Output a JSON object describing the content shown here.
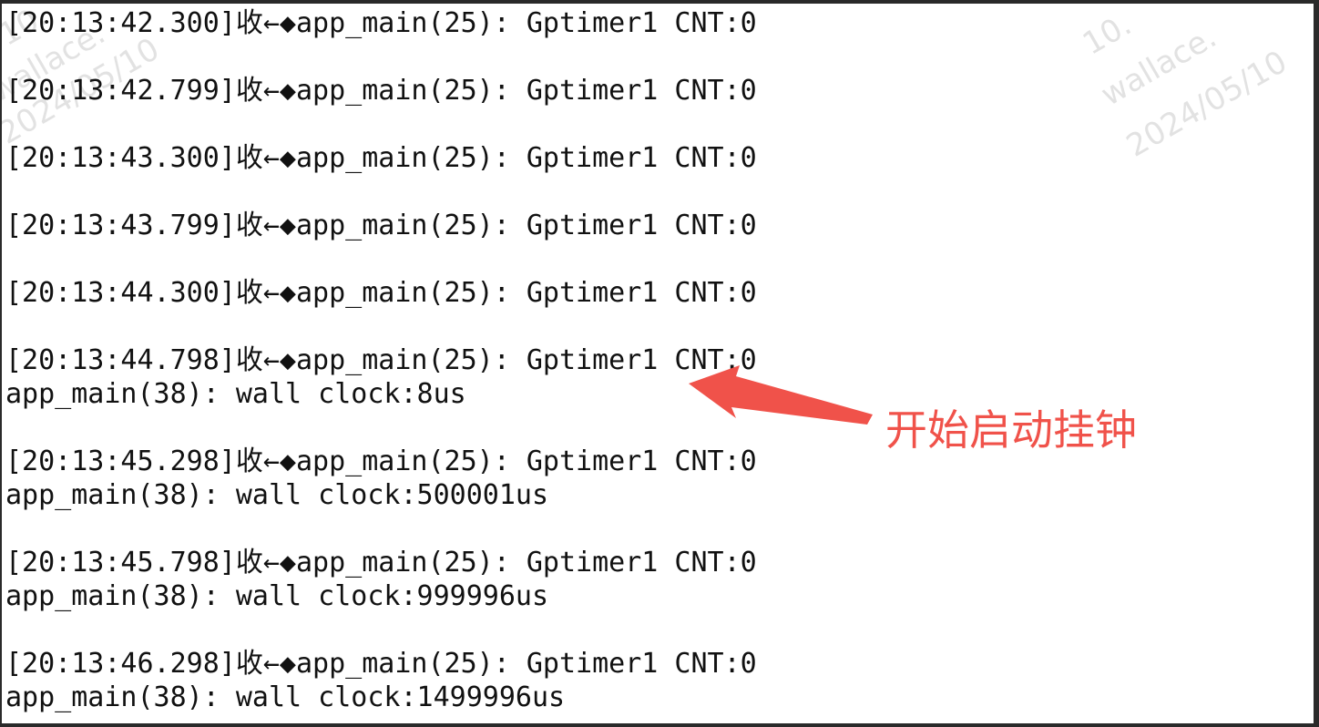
{
  "log": {
    "lines": [
      "[20:13:42.300]收←◆app_main(25): Gptimer1 CNT:0",
      "",
      "[20:13:42.799]收←◆app_main(25): Gptimer1 CNT:0",
      "",
      "[20:13:43.300]收←◆app_main(25): Gptimer1 CNT:0",
      "",
      "[20:13:43.799]收←◆app_main(25): Gptimer1 CNT:0",
      "",
      "[20:13:44.300]收←◆app_main(25): Gptimer1 CNT:0",
      "",
      "[20:13:44.798]收←◆app_main(25): Gptimer1 CNT:0",
      "app_main(38): wall clock:8us",
      "",
      "[20:13:45.298]收←◆app_main(25): Gptimer1 CNT:0",
      "app_main(38): wall clock:500001us",
      "",
      "[20:13:45.798]收←◆app_main(25): Gptimer1 CNT:0",
      "app_main(38): wall clock:999996us",
      "",
      "[20:13:46.298]收←◆app_main(25): Gptimer1 CNT:0",
      "app_main(38): wall clock:1499996us"
    ]
  },
  "annotation": {
    "text": "开始启动挂钟",
    "color": "#f0524a"
  },
  "watermark": {
    "lines": [
      "10.",
      "wallace.",
      "2024/05/10"
    ]
  }
}
